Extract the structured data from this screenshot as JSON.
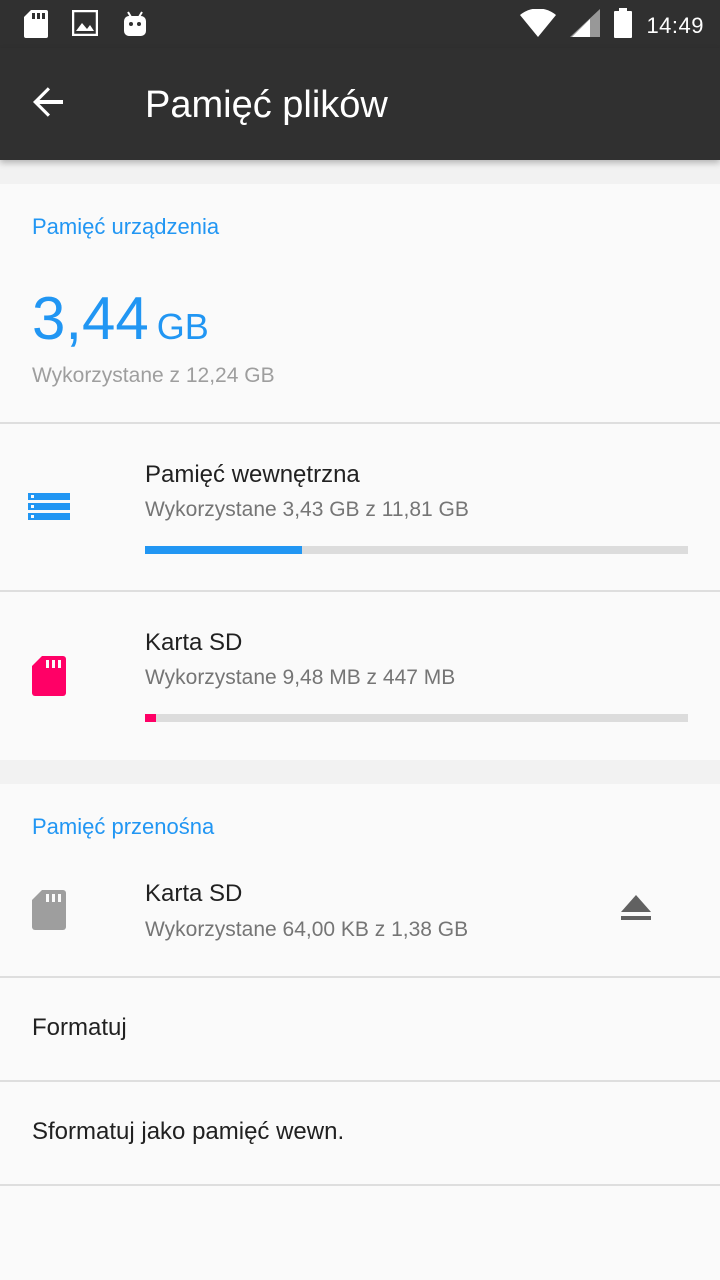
{
  "status_bar": {
    "time": "14:49",
    "icons": [
      "sd-card-notification-icon",
      "image-notification-icon",
      "android-notification-icon",
      "wifi-icon",
      "signal-icon",
      "battery-icon"
    ]
  },
  "app_bar": {
    "title": "Pamięć plików"
  },
  "device_storage": {
    "header": "Pamięć urządzenia",
    "used_value": "3,44",
    "used_unit": "GB",
    "total_text": "Wykorzystane z 12,24 GB",
    "items": [
      {
        "title": "Pamięć wewnętrzna",
        "subtitle": "Wykorzystane 3,43 GB z 11,81 GB",
        "usage_fraction": 0.29,
        "color": "#2196f3",
        "icon": "internal-storage-icon"
      },
      {
        "title": "Karta SD",
        "subtitle": "Wykorzystane 9,48 MB z 447 MB",
        "usage_fraction": 0.02,
        "color": "#ff0066",
        "icon": "sd-card-icon"
      }
    ]
  },
  "portable_storage": {
    "header": "Pamięć przenośna",
    "item": {
      "title": "Karta SD",
      "subtitle": "Wykorzystane 64,00 KB z 1,38 GB",
      "icon": "sd-card-icon"
    },
    "actions": [
      "Formatuj",
      "Sformatuj jako pamięć wewn."
    ]
  },
  "colors": {
    "accent": "#2196f3",
    "sd_accent": "#ff0066",
    "toolbar": "#303030"
  }
}
